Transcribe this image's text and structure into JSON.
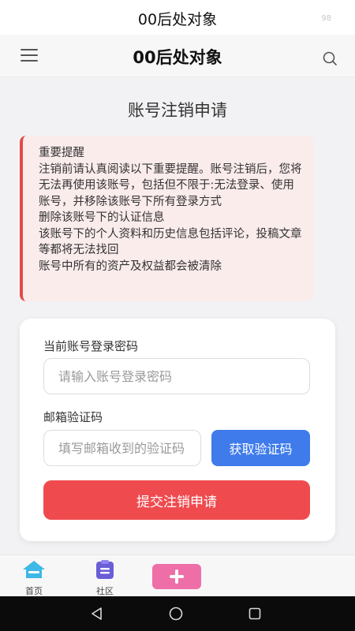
{
  "status_bar": {
    "title": "00后处对象",
    "battery": "98"
  },
  "nav": {
    "title": "00后处对象",
    "menu_icon": "menu-icon",
    "search_icon": "search-icon"
  },
  "page": {
    "title": "账号注销申请"
  },
  "notice": {
    "heading": "重要提醒",
    "body": "注销前请认真阅读以下重要提醒。账号注销后，您将无法再使用该账号，包括但不限于:无法登录、使用账号，并移除该账号下所有登录方式",
    "items": [
      "删除该账号下的认证信息",
      "该账号下的个人资料和历史信息包括评论，投稿文章等都将无法找回",
      "账号中所有的资产及权益都会被清除"
    ],
    "accent_color": "#e24b4b"
  },
  "form": {
    "password_label": "当前账号登录密码",
    "password_placeholder": "请输入账号登录密码",
    "email_code_label": "邮箱验证码",
    "email_code_placeholder": "填写邮箱收到的验证码",
    "get_code_button": "获取验证码",
    "submit_button": "提交注销申请",
    "get_code_color": "#3f7bea",
    "submit_color": "#ef4b4f"
  },
  "tab_bar": {
    "items": [
      {
        "label": "首页",
        "icon": "home-icon"
      },
      {
        "label": "社区",
        "icon": "clipboard-icon"
      }
    ],
    "add_icon": "plus-icon",
    "add_color": "#ee6fa7"
  },
  "system_nav": {
    "back_icon": "back-triangle-icon",
    "home_icon": "home-circle-icon",
    "recent_icon": "recent-square-icon"
  }
}
